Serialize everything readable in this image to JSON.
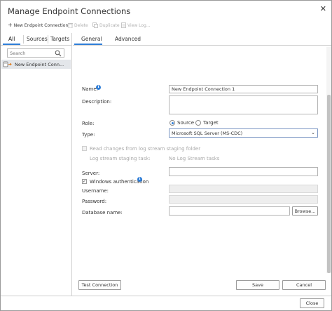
{
  "window": {
    "title": "Manage Endpoint Connections",
    "close_glyph": "✕"
  },
  "toolbar": {
    "new_label": "New Endpoint Connection",
    "delete_label": "Delete",
    "duplicate_label": "Duplicate",
    "view_log_label": "View Log..."
  },
  "left_tabs": [
    "All",
    "Sources",
    "Targets"
  ],
  "search": {
    "placeholder": "Search",
    "value": ""
  },
  "tree": {
    "item_label": "New Endpoint Conn..."
  },
  "right_tabs": [
    "General",
    "Advanced"
  ],
  "form": {
    "name_label": "Name:",
    "name_value": "New Endpoint Connection 1",
    "description_label": "Description:",
    "role_label": "Role:",
    "role_source": "Source",
    "role_target": "Target",
    "type_label": "Type:",
    "type_value": "Microsoft SQL Server (MS-CDC)",
    "read_changes_label": "Read changes from log stream staging folder",
    "log_stream_task_label": "Log stream staging task:",
    "log_stream_task_value": "No Log Stream tasks",
    "server_label": "Server:",
    "windows_auth_label": "Windows authentication",
    "username_label": "Username:",
    "password_label": "Password:",
    "database_label": "Database name:",
    "browse_label": "Browse..."
  },
  "footer": {
    "test_connection": "Test Connection",
    "save": "Save",
    "cancel": "Cancel",
    "close": "Close"
  },
  "colors": {
    "accent": "#2e7dd7",
    "selection": "#e3e6ea",
    "border": "#b5b5b5"
  }
}
